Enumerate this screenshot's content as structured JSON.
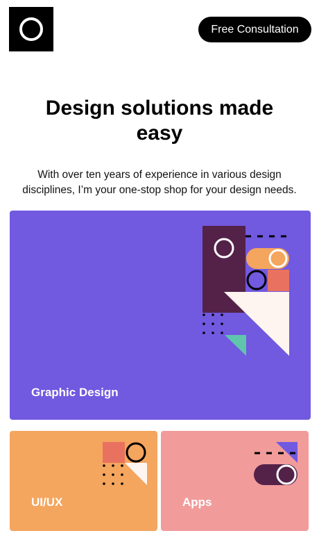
{
  "header": {
    "logo_icon": "ring-logo-icon",
    "cta_label": "Free Consultation"
  },
  "hero": {
    "title": "Design solutions made easy",
    "description": "With over ten years of experience in various design disciplines, I’m your one-stop shop for your design needs."
  },
  "services": [
    {
      "label": "Graphic Design",
      "color": "#7159e0"
    },
    {
      "label": "UI/UX",
      "color": "#f4a55e"
    },
    {
      "label": "Apps",
      "color": "#f19b9b"
    }
  ],
  "colors": {
    "purple": "#7159e0",
    "plum": "#542249",
    "orange": "#f4a55e",
    "coral": "#e8725f",
    "pink": "#f19b9b",
    "cream": "#fff5f0",
    "teal": "#5fc5ad"
  }
}
